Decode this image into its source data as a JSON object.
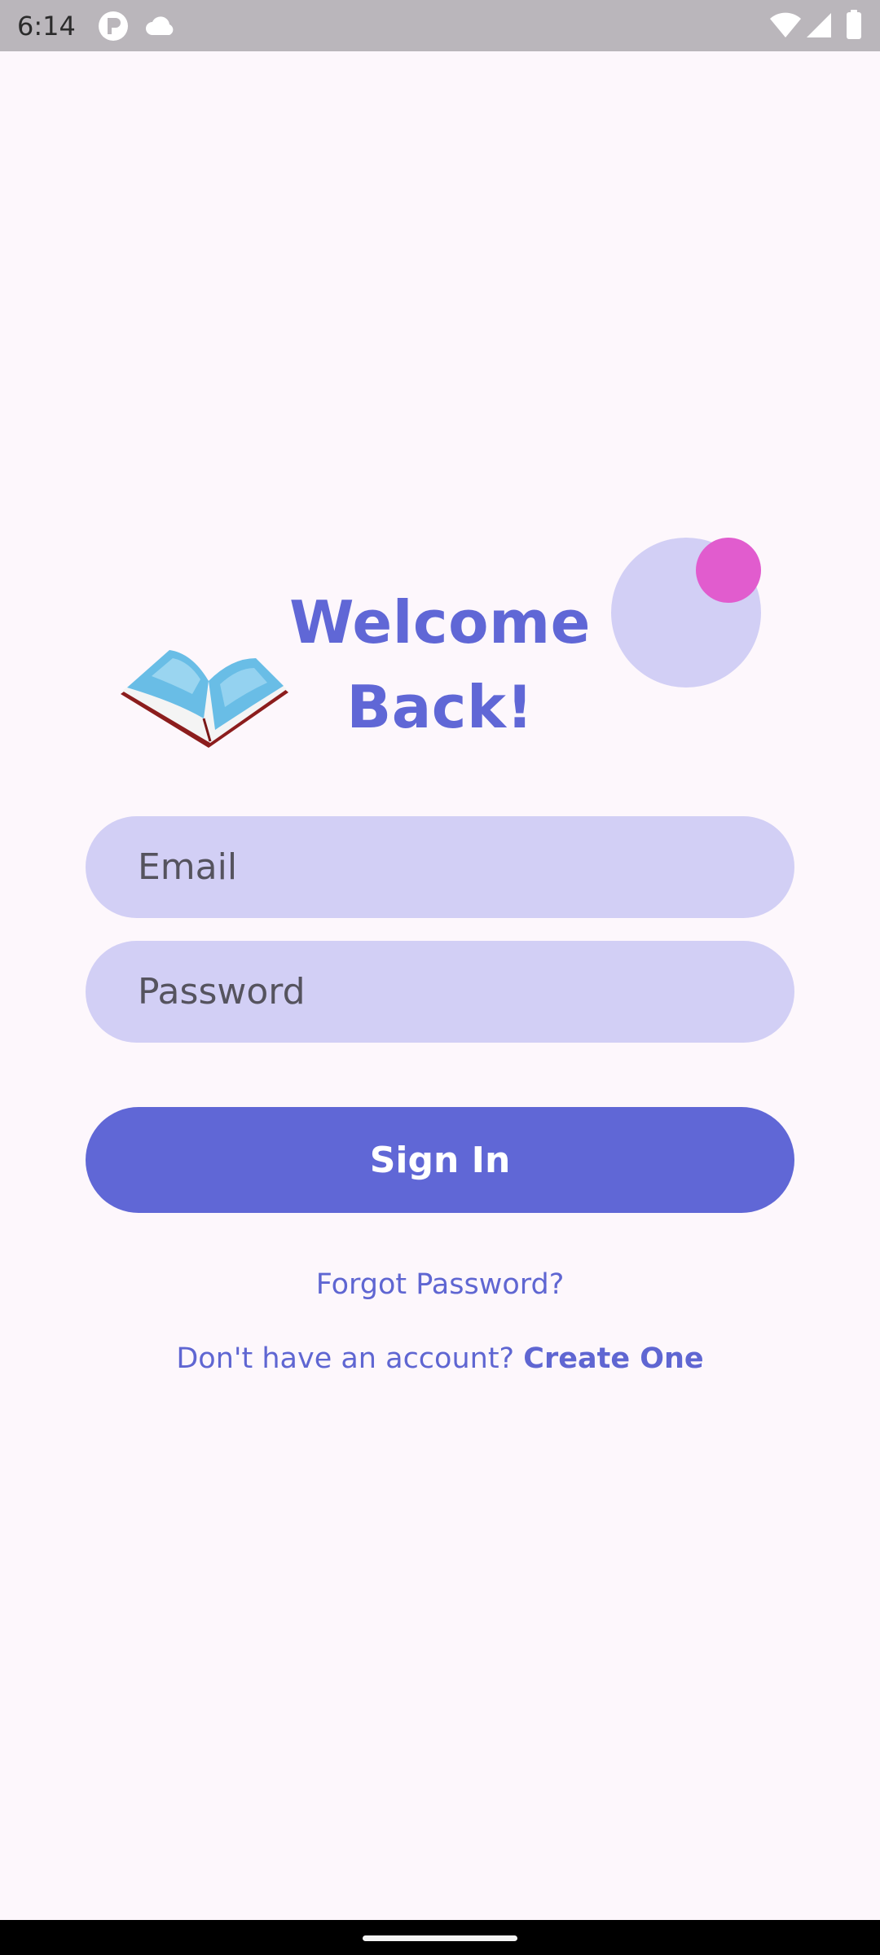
{
  "status_bar": {
    "time": "6:14",
    "left_icons": [
      "p-badge-icon",
      "cloud-icon"
    ],
    "right_icons": [
      "wifi-icon",
      "signal-icon",
      "battery-icon"
    ]
  },
  "header": {
    "title": "Welcome Back!",
    "illustration": "open-book-icon",
    "decoration_colors": {
      "large_circle": "#d2cff5",
      "small_dot": "#e15cce"
    }
  },
  "form": {
    "email_placeholder": "Email",
    "password_placeholder": "Password",
    "sign_in_label": "Sign In"
  },
  "links": {
    "forgot_password": "Forgot Password?",
    "no_account_prompt": "Don't have an account?",
    "create_account": "Create One"
  },
  "colors": {
    "primary": "#6067d6",
    "field_background": "#d2cff5",
    "page_background": "#fdf7fc"
  }
}
